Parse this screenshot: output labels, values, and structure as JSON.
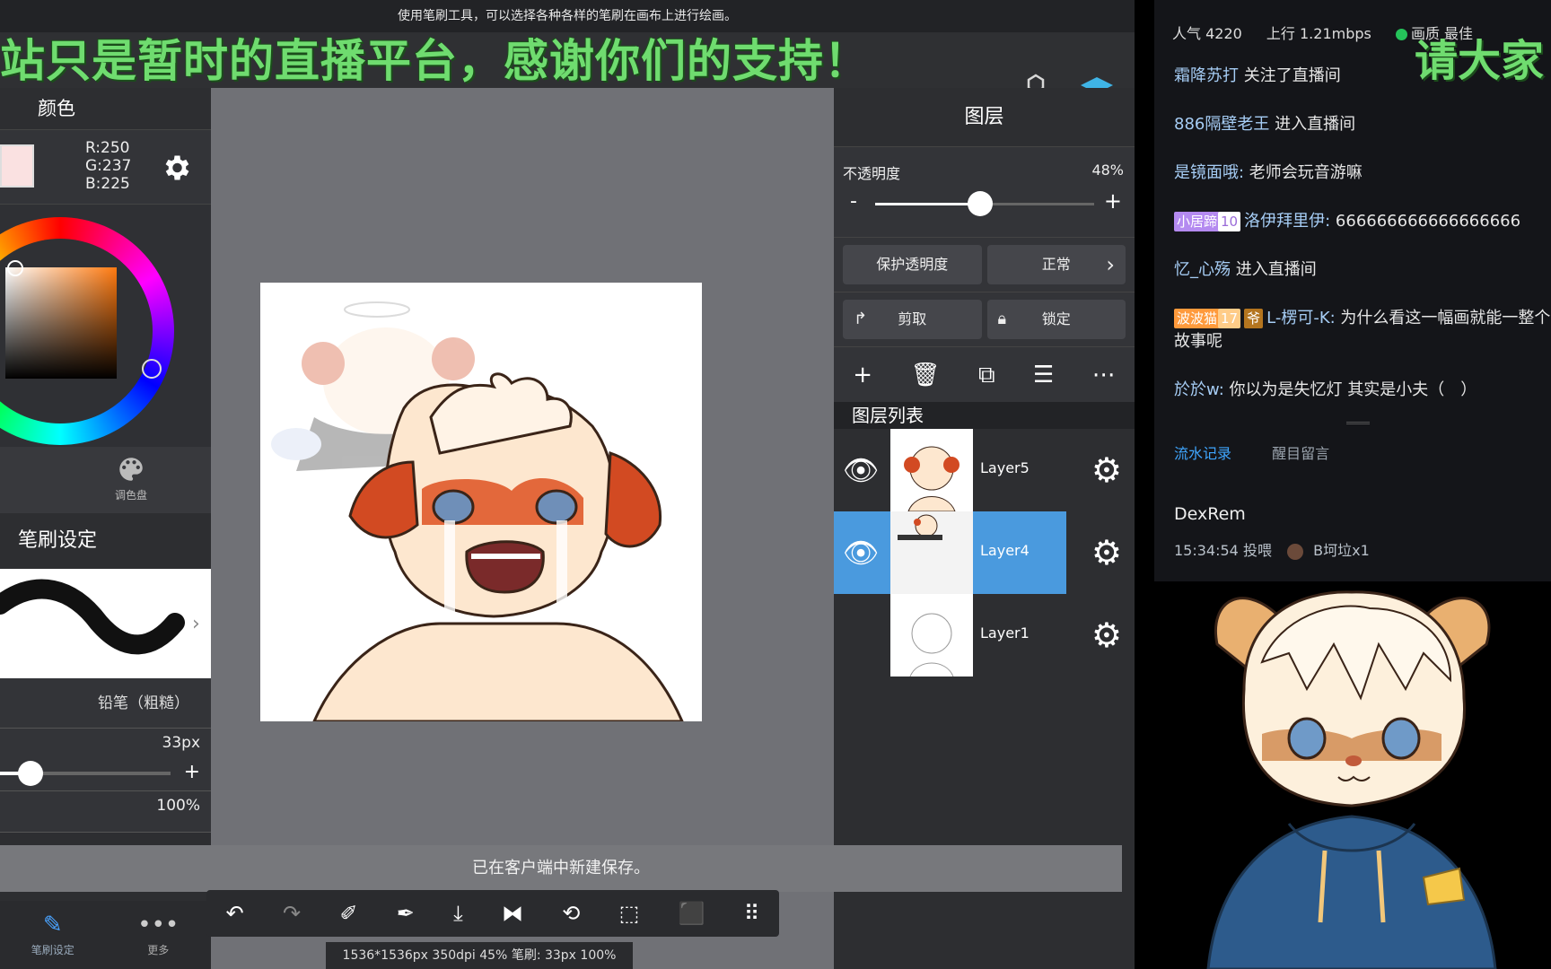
{
  "hint": "使用笔刷工具，可以选择各种各样的笔刷在画布上进行绘画。",
  "ticker_left": "站只是暂时的直播平台，感谢你们的支持！",
  "ticker_right": "请大家",
  "top_icons": [
    "materials-icon",
    "layers-icon"
  ],
  "color_panel": {
    "title": "颜色",
    "swatch_color": "#fae1e1",
    "r": "R:250",
    "g": "G:237",
    "b": "B:225",
    "palette_label": "调色盘"
  },
  "brush_panel": {
    "title": "笔刷设定",
    "brush_name": "铅笔（粗糙）",
    "size_value": "33px",
    "size_fraction": 0.18,
    "opacity_value": "100%"
  },
  "bottom_nav": {
    "brush_settings": "笔刷设定",
    "more": "更多"
  },
  "layers_panel": {
    "title": "图层",
    "opacity_label": "不透明度",
    "opacity_value": "48%",
    "opacity_fraction": 0.48,
    "protect_alpha": "保护透明度",
    "blend_mode": "正常",
    "clip": "剪取",
    "lock": "锁定",
    "list_title": "图层列表",
    "layers": [
      {
        "name": "Layer5",
        "selected": false
      },
      {
        "name": "Layer4",
        "selected": true
      },
      {
        "name": "Layer1",
        "selected": false
      }
    ]
  },
  "toast": "已在客户端中新建保存。",
  "status": "1536*1536px 350dpi 45% 笔刷: 33px 100%",
  "stream": {
    "popularity": "人气 4220",
    "upload": "上行 1.21mbps",
    "indicator_1": "画质 最佳",
    "chat": [
      {
        "user": "霜降苏打",
        "text": " 关注了直播间"
      },
      {
        "user": "886隔壁老王",
        "text": " 进入直播间"
      },
      {
        "user": "是镜面哦:",
        "text": " 老师会玩音游嘛"
      },
      {
        "badge": "小居蹄",
        "level": "10",
        "user": "洛伊拜里伊:",
        "text": " 666666666666666666"
      },
      {
        "user": "忆_心殇",
        "text": " 进入直播间"
      },
      {
        "badge": "波波猫",
        "level": "17",
        "badge2": "爷",
        "user": "L-楞可-K:",
        "text": " 为什么看这一幅画就能一整个故事呢"
      },
      {
        "user": "於於w:",
        "text": " 你以为是失忆灯 其实是小夫（　）"
      }
    ],
    "tab_active": "流水记录",
    "tab_other": "醒目留言",
    "record_name": "DexRem",
    "record_time": "15:34:54 投喂",
    "record_gift": "B坷垃x1"
  }
}
